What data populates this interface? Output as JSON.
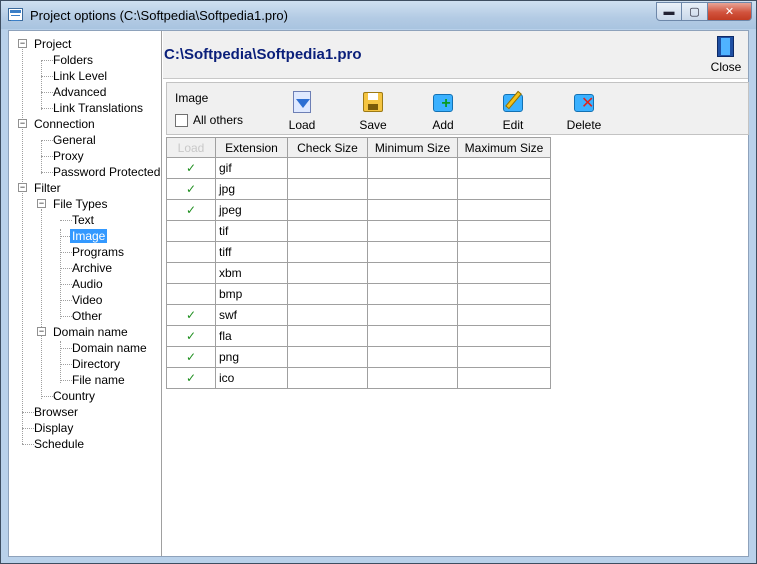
{
  "window": {
    "title": "Project options (C:\\Softpedia\\Softpedia1.pro)",
    "buttons": {
      "minimize": "▬",
      "maximize": "▢",
      "close": "✕"
    }
  },
  "tree": {
    "project": "Project",
    "folders": "Folders",
    "link_level": "Link Level",
    "advanced": "Advanced",
    "link_translations": "Link Translations",
    "connection": "Connection",
    "general": "General",
    "proxy": "Proxy",
    "password_protected": "Password Protected",
    "filter": "Filter",
    "file_types": "File Types",
    "text": "Text",
    "image": "Image",
    "programs": "Programs",
    "archive": "Archive",
    "audio": "Audio",
    "video": "Video",
    "other": "Other",
    "domain_name_group": "Domain name",
    "domain_name": "Domain name",
    "directory": "Directory",
    "file_name": "File name",
    "country": "Country",
    "browser": "Browser",
    "display": "Display",
    "schedule": "Schedule",
    "expander_open": "−",
    "expander_closed": "+"
  },
  "header": {
    "path": "C:\\Softpedia\\Softpedia1.pro",
    "close_label": "Close"
  },
  "toolbar": {
    "group_title": "Image",
    "all_others_label": "All others",
    "load_label": "Load",
    "save_label": "Save",
    "add_label": "Add",
    "edit_label": "Edit",
    "delete_label": "Delete"
  },
  "grid": {
    "columns": [
      "Load",
      "Extension",
      "Check Size",
      "Minimum Size",
      "Maximum Size"
    ],
    "rows": [
      {
        "load": "✓",
        "ext": "gif"
      },
      {
        "load": "✓",
        "ext": "jpg"
      },
      {
        "load": "✓",
        "ext": "jpeg"
      },
      {
        "load": "",
        "ext": "tif"
      },
      {
        "load": "",
        "ext": "tiff"
      },
      {
        "load": "",
        "ext": "xbm"
      },
      {
        "load": "",
        "ext": "bmp"
      },
      {
        "load": "✓",
        "ext": "swf"
      },
      {
        "load": "✓",
        "ext": "fla"
      },
      {
        "load": "✓",
        "ext": "png"
      },
      {
        "load": "✓",
        "ext": "ico"
      }
    ]
  },
  "colors": {
    "path_text": "#0a1f7a",
    "selection": "#3399ff",
    "check": "#1f8f1f"
  },
  "icons": [
    "app-icon",
    "close-door-icon",
    "load-icon",
    "save-icon",
    "add-icon",
    "edit-icon",
    "delete-icon",
    "check-icon"
  ]
}
